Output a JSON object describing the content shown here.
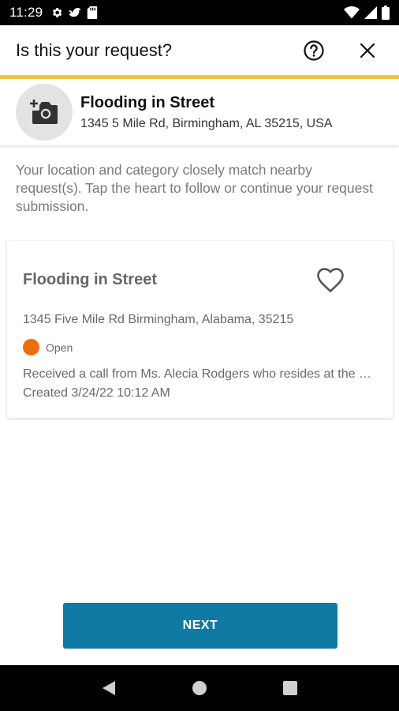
{
  "status_bar": {
    "time": "11:29",
    "icons": [
      "settings-gear-icon",
      "bird-icon",
      "sd-card-icon",
      "wifi-icon",
      "signal-icon",
      "battery-icon"
    ]
  },
  "header": {
    "title": "Is this your request?",
    "help_icon": "help-circle-icon",
    "close_icon": "close-icon",
    "accent_color": "#f5c342"
  },
  "summary": {
    "photo_icon": "add-photo-icon",
    "title": "Flooding in Street",
    "address": "1345 5 Mile Rd, Birmingham, AL 35215, USA"
  },
  "info_text": "Your location and category closely match nearby request(s). Tap the heart to follow or continue your request submission.",
  "nearby_requests": [
    {
      "title": "Flooding in Street",
      "address": "1345 Five Mile Rd Birmingham, Alabama, 35215",
      "status": "Open",
      "status_color": "#ee6c0c",
      "description": "Received a call from Ms. Alecia Rodgers who resides at the address",
      "created": "Created 3/24/22 10:12 AM",
      "follow_icon": "heart-outline-icon"
    }
  ],
  "actions": {
    "next_label": "NEXT",
    "button_color": "#0f7aa3"
  },
  "nav_bar": {
    "icons": [
      "back-icon",
      "home-icon",
      "recents-icon"
    ]
  }
}
